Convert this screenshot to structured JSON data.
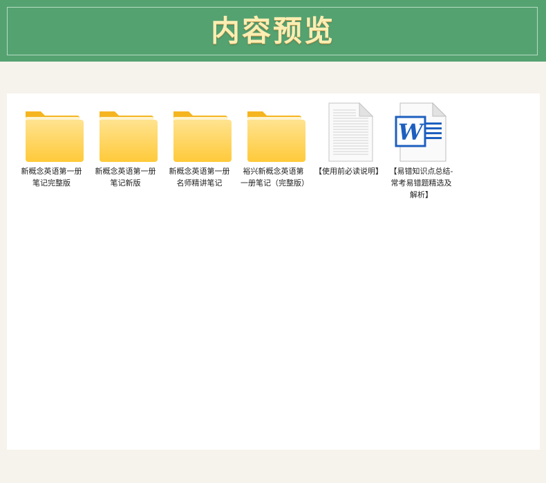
{
  "banner": {
    "title": "内容预览"
  },
  "files": [
    {
      "type": "folder",
      "icon": "folder-icon",
      "name": "新概念英语第一册笔记完整版"
    },
    {
      "type": "folder",
      "icon": "folder-icon",
      "name": "新概念英语第一册笔记新版"
    },
    {
      "type": "folder",
      "icon": "folder-icon",
      "name": "新概念英语第一册名师精讲笔记"
    },
    {
      "type": "folder",
      "icon": "folder-icon",
      "name": "裕兴新概念英语第一册笔记（完整版）"
    },
    {
      "type": "text",
      "icon": "text-file-icon",
      "name": "【使用前必读说明】"
    },
    {
      "type": "word",
      "icon": "word-document-icon",
      "name": "【易错知识点总结-常考易错题精选及解析】"
    }
  ],
  "colors": {
    "banner": "#55a271",
    "title": "#fbeeb3",
    "folder": "#ffc93d",
    "word": "#1d5fbf"
  }
}
